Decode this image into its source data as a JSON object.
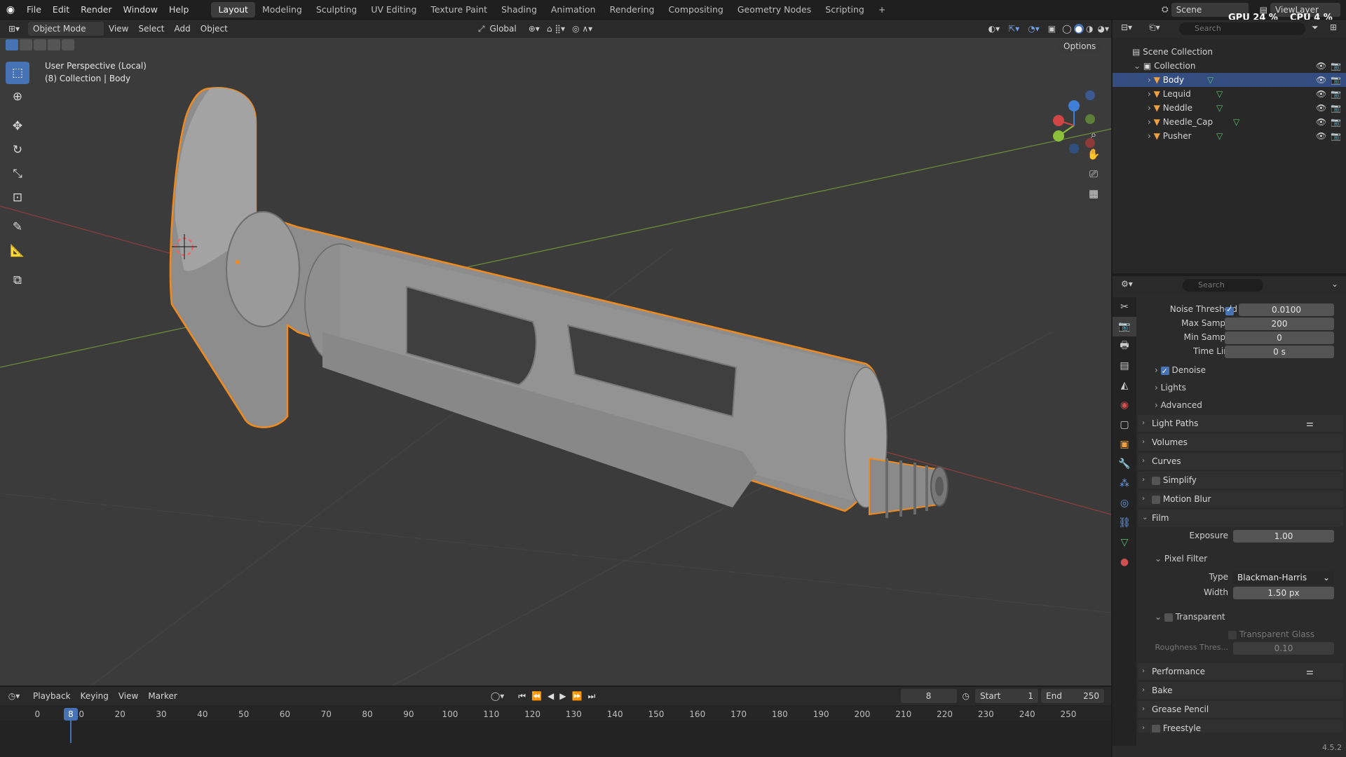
{
  "topbar": {
    "menus": [
      "File",
      "Edit",
      "Render",
      "Window",
      "Help"
    ],
    "workspaces": [
      "Layout",
      "Modeling",
      "Sculpting",
      "UV Editing",
      "Texture Paint",
      "Shading",
      "Animation",
      "Rendering",
      "Compositing",
      "Geometry Nodes",
      "Scripting"
    ],
    "add": "+",
    "scene": "Scene",
    "view_layer": "ViewLayer",
    "gpu_label": "GPU",
    "gpu_value": "24 %",
    "cpu_label": "CPU",
    "cpu_value": "4 %"
  },
  "viewport_header": {
    "mode": "Object Mode",
    "menus": [
      "View",
      "Select",
      "Add",
      "Object"
    ],
    "orientation": "Global",
    "options": "Options"
  },
  "viewport": {
    "perspective": "User Perspective (Local)",
    "collection_info": "(8) Collection | Body"
  },
  "outliner": {
    "search_placeholder": "Search",
    "scene_collection": "Scene Collection",
    "collection": "Collection",
    "objects": [
      {
        "name": "Body",
        "selected": true
      },
      {
        "name": "Lequid",
        "selected": false
      },
      {
        "name": "Neddle",
        "selected": false
      },
      {
        "name": "Needle_Cap",
        "selected": false
      },
      {
        "name": "Pusher",
        "selected": false
      }
    ]
  },
  "properties": {
    "search_placeholder": "Search",
    "noise_threshold_label": "Noise Threshold",
    "noise_threshold": "0.0100",
    "max_samples_label": "Max Samples",
    "max_samples": "200",
    "min_samples_label": "Min Samples",
    "min_samples": "0",
    "time_limit_label": "Time Limit",
    "time_limit": "0 s",
    "denoise": "Denoise",
    "lights": "Lights",
    "advanced": "Advanced",
    "light_paths": "Light Paths",
    "volumes": "Volumes",
    "curves": "Curves",
    "simplify": "Simplify",
    "motion_blur": "Motion Blur",
    "film": "Film",
    "exposure_label": "Exposure",
    "exposure": "1.00",
    "pixel_filter": "Pixel Filter",
    "type_label": "Type",
    "type_value": "Blackman-Harris",
    "width_label": "Width",
    "width_value": "1.50 px",
    "transparent": "Transparent",
    "transparent_glass": "Transparent Glass",
    "roughness_label": "Roughness Thres...",
    "roughness_value": "0.10",
    "performance": "Performance",
    "bake": "Bake",
    "grease_pencil": "Grease Pencil",
    "freestyle": "Freestyle"
  },
  "timeline": {
    "menus": [
      "Playback",
      "Keying",
      "View",
      "Marker"
    ],
    "current_frame": "8",
    "start_label": "Start",
    "start": "1",
    "end_label": "End",
    "end": "250",
    "ticks": [
      "0",
      "10",
      "20",
      "30",
      "40",
      "50",
      "60",
      "70",
      "80",
      "90",
      "100",
      "110",
      "120",
      "130",
      "140",
      "150",
      "160",
      "170",
      "180",
      "190",
      "200",
      "210",
      "220",
      "230",
      "240",
      "250"
    ],
    "version": "4.5.2"
  },
  "colors": {
    "accent": "#4772b3",
    "selection_outline": "#ff8c1a",
    "header": "#2a2a2a",
    "viewport_bg": "#3b3b3b"
  }
}
